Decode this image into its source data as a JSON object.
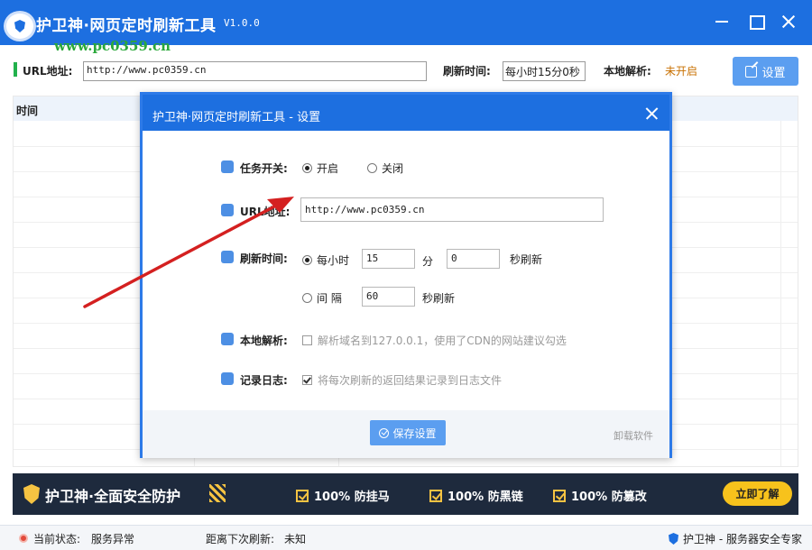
{
  "window": {
    "title": "护卫神·网页定时刷新工具",
    "version": "V1.0.0",
    "watermark": "www.pc0359.cn"
  },
  "toolbar": {
    "url_label": "URL地址:",
    "url_value": "http://www.pc0359.cn",
    "refresh_label": "刷新时间:",
    "refresh_value": "每小时15分0秒",
    "local_label": "本地解析:",
    "local_value": "未开启",
    "settings_label": "设置"
  },
  "table": {
    "headers": [
      "时间"
    ]
  },
  "banner": {
    "title": "护卫神·全面安全防护",
    "features": [
      "100% 防挂马",
      "100% 防黑链",
      "100% 防篡改"
    ],
    "learn_more": "立即了解"
  },
  "statusbar": {
    "state_label": "当前状态:",
    "state_value": "服务异常",
    "next_label": "距离下次刷新:",
    "next_value": "未知",
    "brand": "护卫神 - 服务器安全专家"
  },
  "dialog": {
    "title": "护卫神·网页定时刷新工具 - 设置",
    "task_label": "任务开关:",
    "task_on": "开启",
    "task_off": "关闭",
    "url_label": "URL地址:",
    "url_value": "http://www.pc0359.cn",
    "refresh_label": "刷新时间:",
    "hourly_label": "每小时",
    "minutes_value": "15",
    "minutes_unit": "分",
    "seconds_value": "0",
    "seconds_unit": "秒刷新",
    "interval_label": "间 隔",
    "interval_value": "60",
    "interval_unit": "秒刷新",
    "local_label": "本地解析:",
    "local_text": "解析域名到127.0.0.1，使用了CDN的网站建议勾选",
    "log_label": "记录日志:",
    "log_text": "将每次刷新的返回结果记录到日志文件",
    "save_label": "保存设置",
    "uninstall_label": "卸载软件"
  },
  "colors": {
    "titlebar": "#1d6fe0",
    "button": "#5b9ef0",
    "banner": "#1e2a3d",
    "accent_yellow": "#f6c342",
    "annotation_arrow": "#d42020"
  }
}
